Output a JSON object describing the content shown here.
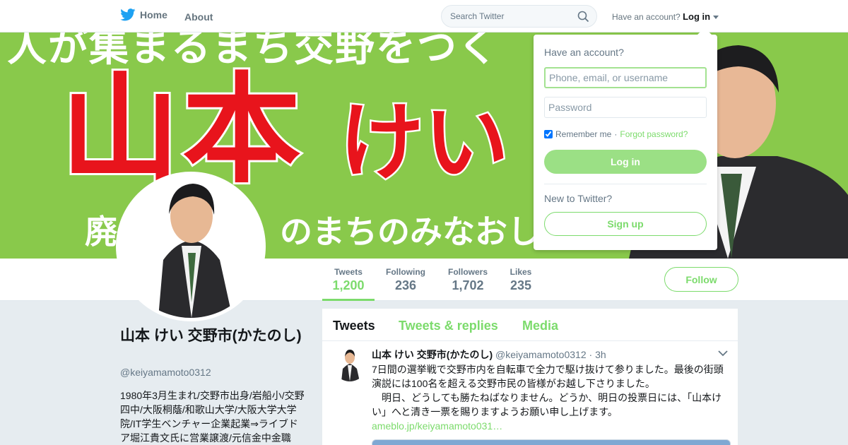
{
  "nav": {
    "home_label": "Home",
    "about_label": "About",
    "search_placeholder": "Search Twitter",
    "have_account_label": "Have an account?",
    "login_label": "Log in"
  },
  "banner": {
    "top_text": "人が集まるまち交野をつく",
    "name_text": "山本",
    "kana_text": "けい",
    "slogan_text": "廃　　　　　のまちのみなおし"
  },
  "stats": [
    {
      "label": "Tweets",
      "value": "1,200"
    },
    {
      "label": "Following",
      "value": "236"
    },
    {
      "label": "Followers",
      "value": "1,702"
    },
    {
      "label": "Likes",
      "value": "235"
    }
  ],
  "follow_label": "Follow",
  "profile": {
    "name": "山本 けい 交野市(かたのし)",
    "handle": "@keiyamamoto0312",
    "bio": "1980年3月生まれ/交野市出身/岩船小/交野四中/大阪桐蔭/和歌山大学/大阪大学大学院/IT学生ベンチャー企業起業⇒ライブドア堀江貴文氏に営業譲渡/元信金中金職"
  },
  "timeline": {
    "tabs": [
      "Tweets",
      "Tweets & replies",
      "Media"
    ]
  },
  "tweet": {
    "fullname": "山本 けい 交野市(かたのし)",
    "handle": "@keiyamamoto0312",
    "separator": "·",
    "time": "3h",
    "text": "7日間の選挙戦で交野市内を自転車で全力で駆け抜けて参りました。最後の街頭演説には100名を超える交野市民の皆様がお越し下さりました。\n　明日、どうしても勝たねばなりません。どうか、明日の投票日には、「山本けい」へと清き一票を賜りますようお願い申し上げます。",
    "link": "ameblo.jp/keiyamamoto031…"
  },
  "login_dropdown": {
    "title": "Have an account?",
    "username_placeholder": "Phone, email, or username",
    "password_placeholder": "Password",
    "remember_label": "Remember me",
    "separator": "·",
    "forgot_label": "Forgot password?",
    "login_button": "Log in",
    "new_label": "New to Twitter?",
    "signup_button": "Sign up"
  },
  "colors": {
    "accent": "#7cdb6c",
    "banner_green": "#89c94b",
    "banner_red": "#e8141c",
    "twitter_blue": "#1da1f2"
  }
}
